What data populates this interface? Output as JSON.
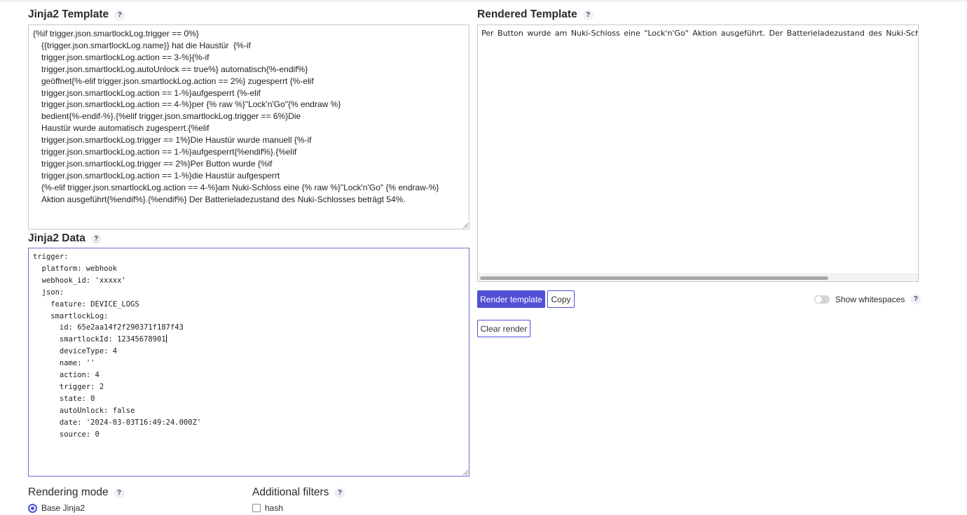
{
  "template_section": {
    "title": "Jinja2 Template",
    "help": "?",
    "lines": [
      "{%if trigger.json.smartlockLog.trigger == 0%}",
      "{{trigger.json.smartlockLog.name}} hat die Haustür  {%-if",
      "trigger.json.smartlockLog.action == 3-%}{%-if",
      "trigger.json.smartlockLog.autoUnlock == true%} automatisch{%-endif%}",
      "geöffnet{%-elif trigger.json.smartlockLog.action == 2%} zugesperrt {%-elif",
      "trigger.json.smartlockLog.action == 1-%}aufgesperrt {%-elif",
      "trigger.json.smartlockLog.action == 4-%}per {% raw %}\"Lock'n'Go\"{% endraw %}",
      "bedient{%-endif-%}.{%elif trigger.json.smartlockLog.trigger == 6%}Die",
      "Haustür wurde automatisch zugesperrt.{%elif",
      "trigger.json.smartlockLog.trigger == 1%}Die Haustür wurde manuell {%-if",
      "trigger.json.smartlockLog.action == 1-%}aufgesperrt{%endif%}.{%elif",
      "trigger.json.smartlockLog.trigger == 2%}Per Button wurde {%if",
      "trigger.json.smartlockLog.action == 1-%}die Haustür aufgesperrt",
      "{%-elif trigger.json.smartlockLog.action == 4-%}am Nuki-Schloss eine {% raw %}\"Lock'n'Go\" {% endraw-%}",
      "Aktion ausgeführt{%endif%}.{%endif%} Der Batterieladezustand des Nuki-Schlosses beträgt 54%."
    ]
  },
  "data_section": {
    "title": "Jinja2 Data",
    "help": "?",
    "lines": [
      "trigger:",
      "  platform: webhook",
      "  webhook_id: 'xxxxx'",
      "  json:",
      "    feature: DEVICE_LOGS",
      "    smartlockLog:",
      "      id: 65e2aa14f2f290371f187f43",
      "      smartlockId: 12345678901",
      "      deviceType: 4",
      "      name: ''",
      "      action: 4",
      "      trigger: 2",
      "      state: 0",
      "      autoUnlock: false",
      "      date: '2024-03-03T16:49:24.000Z'",
      "      source: 0"
    ]
  },
  "rendered_section": {
    "title": "Rendered Template",
    "help": "?",
    "output": "Per Button wurde am Nuki-Schloss eine \"Lock'n'Go\" Aktion ausgeführt. Der Batterieladezustand des Nuki-Schlosses be",
    "render_button": "Render template",
    "copy_button": "Copy",
    "clear_button": "Clear render",
    "show_whitespaces_label": "Show whitespaces",
    "show_whitespaces_help": "?",
    "show_whitespaces_on": false
  },
  "rendering_mode": {
    "title": "Rendering mode",
    "help": "?",
    "selected_option": "Base Jinja2"
  },
  "additional_filters": {
    "title": "Additional filters",
    "help": "?",
    "option": "hash",
    "checked": false
  },
  "colors": {
    "accent": "#5050d6",
    "border": "#c7c7c7"
  }
}
